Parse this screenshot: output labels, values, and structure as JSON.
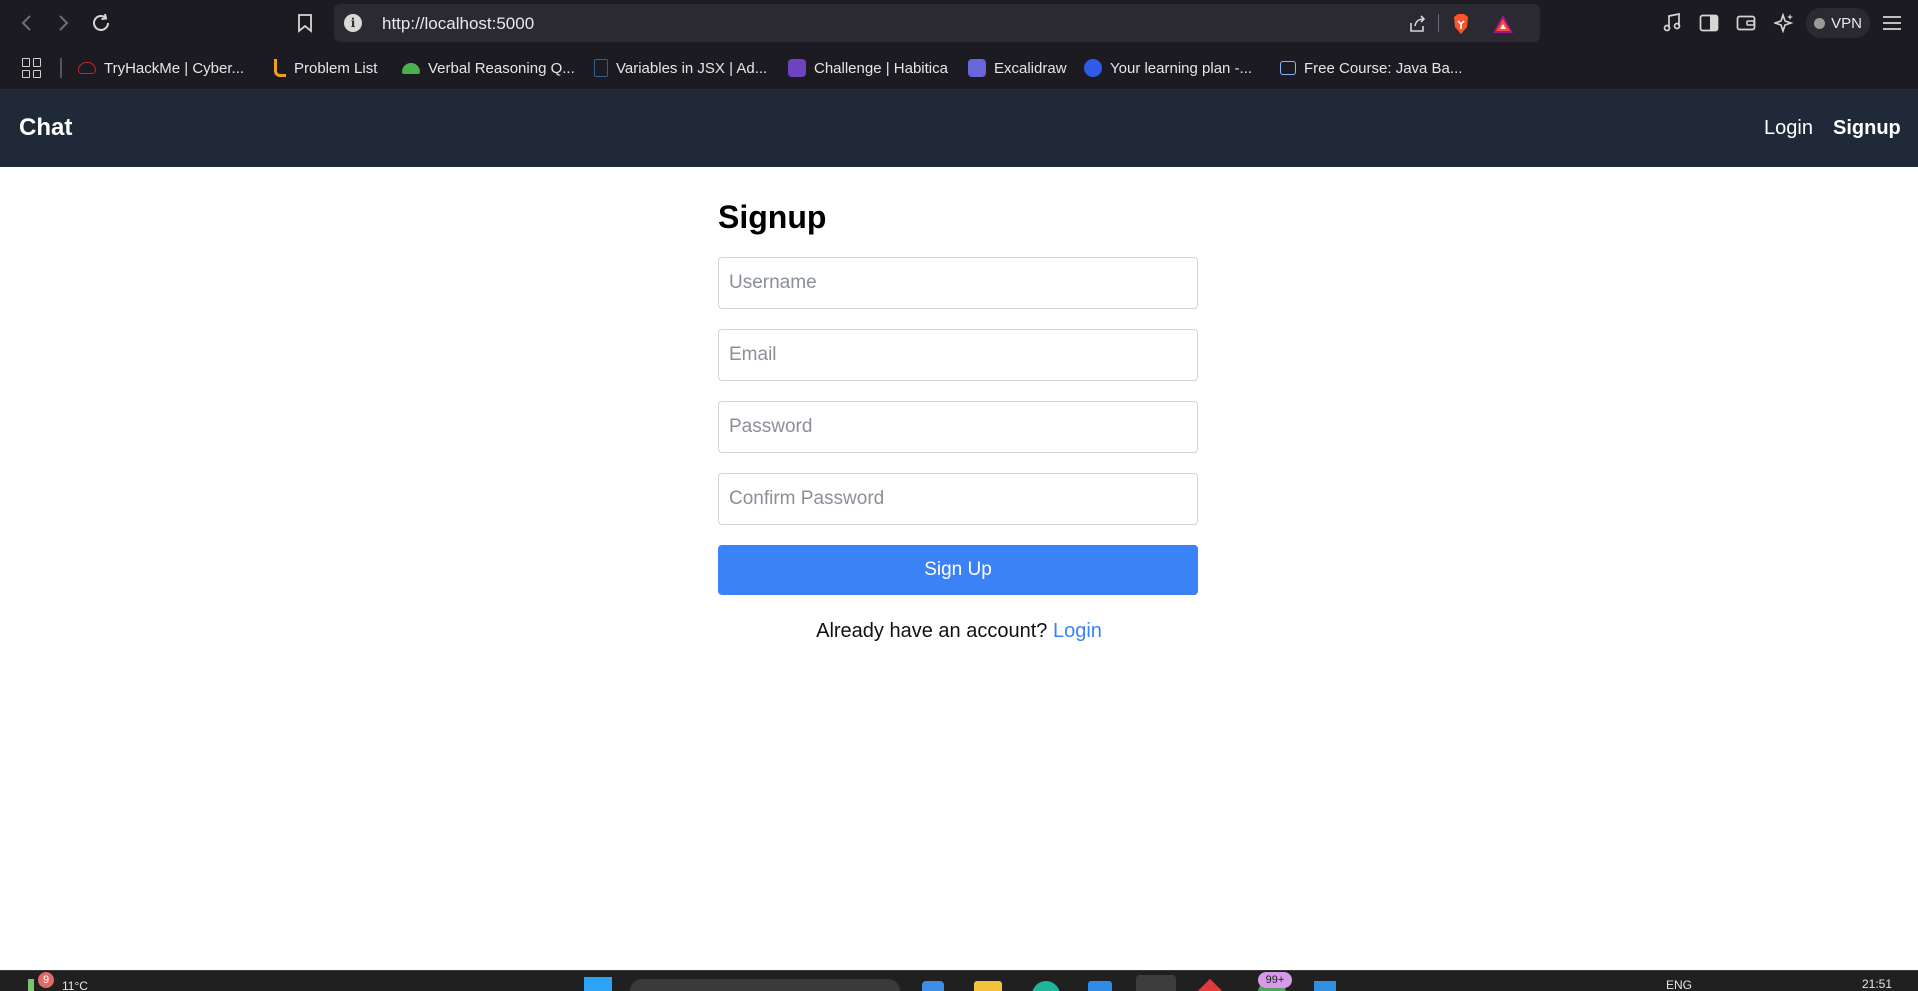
{
  "browser": {
    "url": "http://localhost:5000",
    "vpn_label": "VPN",
    "bookmarks": [
      {
        "label": "TryHackMe | Cyber...",
        "color": "#c9232c"
      },
      {
        "label": "Problem List",
        "color": "#f0a020"
      },
      {
        "label": "Verbal Reasoning Q...",
        "color": "#4caf50"
      },
      {
        "label": "Variables in JSX | Ad...",
        "color": "#2b5f8f"
      },
      {
        "label": "Challenge | Habitica",
        "color": "#6f42c1"
      },
      {
        "label": "Excalidraw",
        "color": "#6965db"
      },
      {
        "label": "Your learning plan -...",
        "color": "#2f5bea"
      },
      {
        "label": "Free Course: Java Ba...",
        "color": "#8ab4f8"
      }
    ]
  },
  "navbar": {
    "brand": "Chat",
    "login_label": "Login",
    "signup_label": "Signup"
  },
  "form": {
    "title": "Signup",
    "username_placeholder": "Username",
    "email_placeholder": "Email",
    "password_placeholder": "Password",
    "confirm_placeholder": "Confirm Password",
    "submit_label": "Sign Up",
    "switch_text": "Already have an account?",
    "switch_link": "Login"
  },
  "taskbar": {
    "weather_badge": "9",
    "temperature": "11°C",
    "notification_badge": "99+",
    "language": "ENG",
    "time": "21:51"
  },
  "colors": {
    "navbar_bg": "#1f2937",
    "primary": "#3b82f6"
  }
}
